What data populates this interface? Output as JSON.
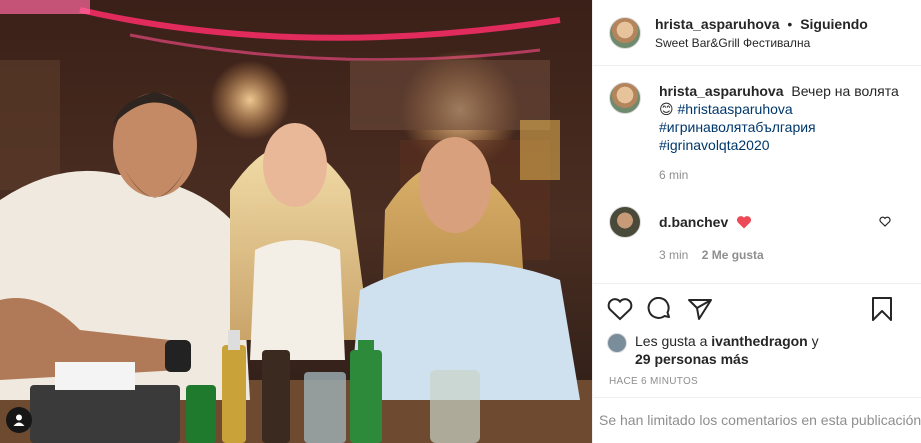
{
  "post": {
    "username": "hrista_asparuhova",
    "follow_status": "Siguiendo",
    "location": "Sweet Bar&Grill Фестивална"
  },
  "caption": {
    "username": "hrista_asparuhova",
    "text": "Вечер на волята",
    "emoji": "😊",
    "hashtags": [
      "#hristaasparuhova",
      "#игринаволятабългария",
      "#igrinavolqta2020"
    ],
    "time": "6 min"
  },
  "reply": {
    "username": "d.banchev",
    "time": "3 min",
    "likes": "2 Me gusta"
  },
  "likes": {
    "prefix": "Les gusta a",
    "user": "ivanthedragon",
    "connector": "y",
    "others": "29 personas más"
  },
  "posted_ago": "HACE 6 MINUTOS",
  "comments_limited": "Se han limitado los comentarios en esta publicación.",
  "icons": {
    "like": "heart-outline-icon",
    "comment": "comment-bubble-icon",
    "share": "paper-plane-icon",
    "save": "bookmark-icon",
    "reply_heart": "heart-red-icon",
    "tagged_user": "user-tag-icon"
  },
  "colors": {
    "hashtag": "#00376b",
    "muted": "#8e8e8e",
    "heart_red": "#ed4956"
  }
}
